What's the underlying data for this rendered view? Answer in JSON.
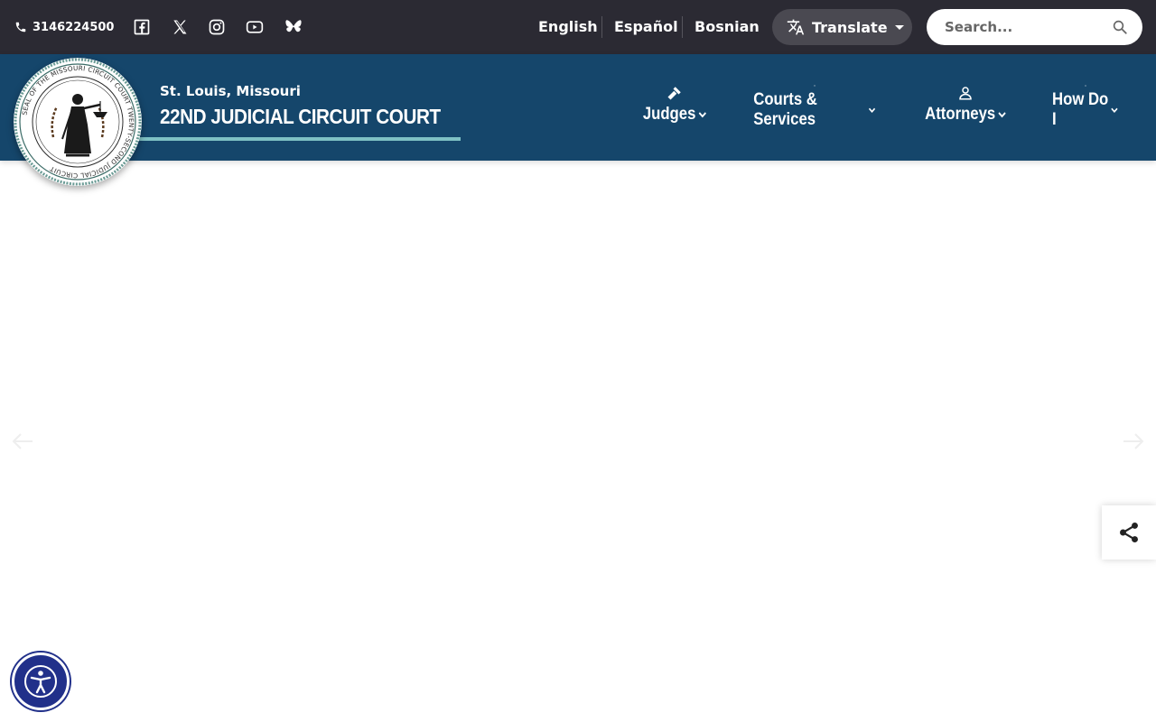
{
  "topbar": {
    "phone": "3146224500",
    "social": [
      "facebook-icon",
      "x-icon",
      "instagram-icon",
      "youtube-icon",
      "bluesky-icon"
    ],
    "languages": [
      "English",
      "Español",
      "Bosnian"
    ],
    "translate_label": "Translate",
    "search_placeholder": "Search..."
  },
  "header": {
    "subtitle": "St. Louis, Missouri",
    "title": "22ND JUDICIAL CIRCUIT COURT",
    "nav": [
      {
        "label": "Judges",
        "icon": "gavel-icon"
      },
      {
        "label": "Courts & Services",
        "icon": "scales-icon"
      },
      {
        "label": "Attorneys",
        "icon": "person-icon"
      },
      {
        "label": "How Do I",
        "icon": "info-icon"
      }
    ]
  },
  "colors": {
    "topbar_bg": "#2b2a33",
    "header_bg": "#15466b",
    "accent_underline": "#7fc1c4",
    "a11y_bg": "#21308a"
  }
}
